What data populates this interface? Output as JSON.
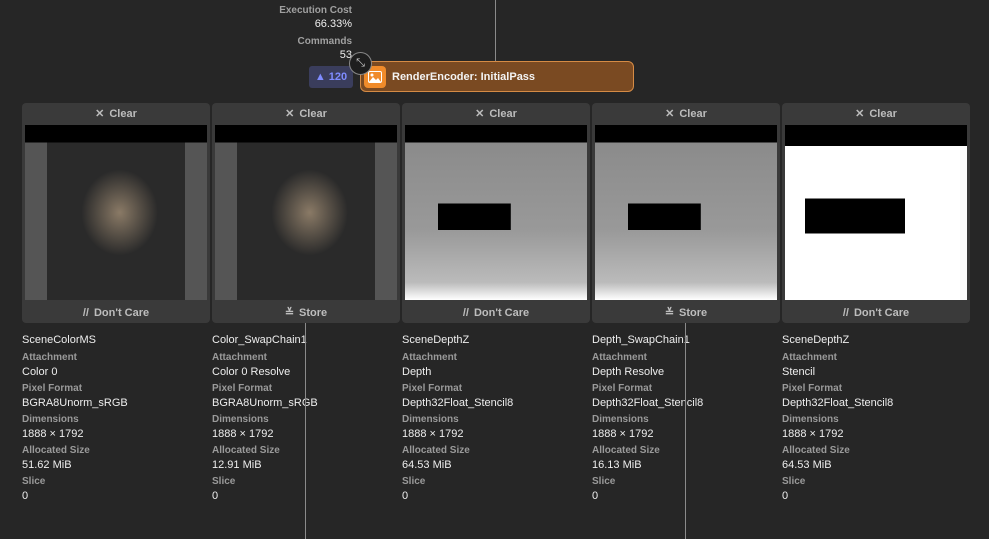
{
  "stats": {
    "execution_cost_label": "Execution Cost",
    "execution_cost": "66.33%",
    "commands_label": "Commands",
    "commands": "53"
  },
  "warnings": {
    "count": "120",
    "icon": "warning-triangle-icon",
    "color": "#7f8cff"
  },
  "encoder": {
    "title": "RenderEncoder: InitialPass",
    "icon": "image-icon",
    "color": "#f08b2a"
  },
  "labels": {
    "attachment": "Attachment",
    "pixel_format": "Pixel Format",
    "dimensions": "Dimensions",
    "allocated_size": "Allocated Size",
    "slice": "Slice"
  },
  "attachments": [
    {
      "load": "Clear",
      "store": "Don't Care",
      "name": "SceneColorMS",
      "attachment": "Color 0",
      "pixel_format": "BGRA8Unorm_sRGB",
      "dimensions": "1888 × 1792",
      "allocated_size": "51.62 MiB",
      "slice": "0",
      "kind": "color"
    },
    {
      "load": "Clear",
      "store": "Store",
      "name": "Color_SwapChain1",
      "attachment": "Color 0 Resolve",
      "pixel_format": "BGRA8Unorm_sRGB",
      "dimensions": "1888 × 1792",
      "allocated_size": "12.91 MiB",
      "slice": "0",
      "kind": "color"
    },
    {
      "load": "Clear",
      "store": "Don't Care",
      "name": "SceneDepthZ",
      "attachment": "Depth",
      "pixel_format": "Depth32Float_Stencil8",
      "dimensions": "1888 × 1792",
      "allocated_size": "64.53 MiB",
      "slice": "0",
      "kind": "depth"
    },
    {
      "load": "Clear",
      "store": "Store",
      "name": "Depth_SwapChain1",
      "attachment": "Depth Resolve",
      "pixel_format": "Depth32Float_Stencil8",
      "dimensions": "1888 × 1792",
      "allocated_size": "16.13 MiB",
      "slice": "0",
      "kind": "depth"
    },
    {
      "load": "Clear",
      "store": "Don't Care",
      "name": "SceneDepthZ",
      "attachment": "Stencil",
      "pixel_format": "Depth32Float_Stencil8",
      "dimensions": "1888 × 1792",
      "allocated_size": "64.53 MiB",
      "slice": "0",
      "kind": "stencil"
    }
  ]
}
